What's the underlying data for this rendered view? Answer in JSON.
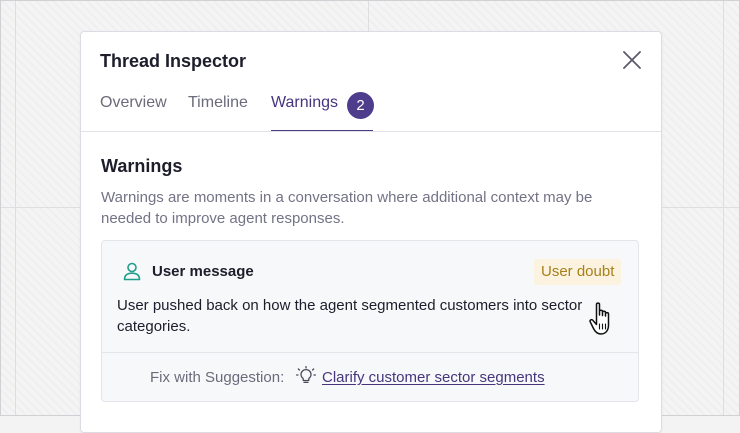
{
  "panel": {
    "title": "Thread Inspector",
    "close_icon": "close-icon",
    "tabs": [
      {
        "label": "Overview",
        "active": false
      },
      {
        "label": "Timeline",
        "active": false
      },
      {
        "label": "Warnings",
        "active": true,
        "badge": "2"
      }
    ]
  },
  "warnings_section": {
    "title": "Warnings",
    "description": "Warnings are moments in a conversation where additional context may be needed to improve agent responses."
  },
  "warning_card": {
    "icon": "user-icon",
    "heading": "User message",
    "tag": "User doubt",
    "body": "User pushed back on how the agent segmented customers into sector categories.",
    "fix_label": "Fix with Suggestion:",
    "fix_icon": "lightbulb-icon",
    "fix_link": "Clarify customer sector segments"
  },
  "colors": {
    "accent": "#4e3d8c",
    "tag_background": "#fbf3df",
    "tag_text": "#a8801b",
    "user_icon": "#1f9e8c"
  },
  "pointer": "hand-cursor-icon"
}
